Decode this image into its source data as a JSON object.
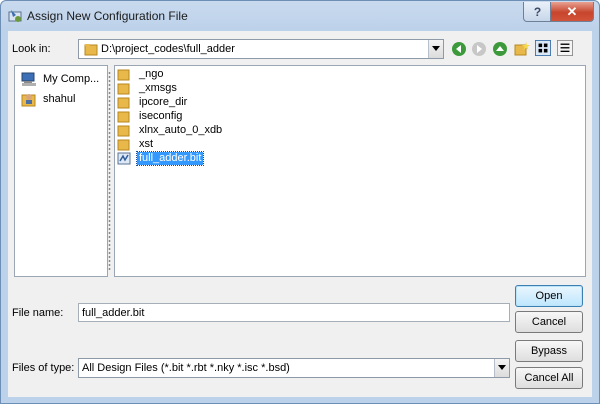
{
  "window": {
    "title": "Assign New Configuration File"
  },
  "look_in": {
    "label": "Look in:",
    "path": "D:\\project_codes\\full_adder"
  },
  "places": [
    {
      "label": "My Comp...",
      "icon": "computer-icon"
    },
    {
      "label": "shahul",
      "icon": "user-folder-icon"
    }
  ],
  "files": [
    {
      "name": "_ngo",
      "icon": "folder-icon",
      "selected": false
    },
    {
      "name": "_xmsgs",
      "icon": "folder-icon",
      "selected": false
    },
    {
      "name": "ipcore_dir",
      "icon": "folder-icon",
      "selected": false
    },
    {
      "name": "iseconfig",
      "icon": "folder-icon",
      "selected": false
    },
    {
      "name": "xlnx_auto_0_xdb",
      "icon": "folder-icon",
      "selected": false
    },
    {
      "name": "xst",
      "icon": "folder-icon",
      "selected": false
    },
    {
      "name": "full_adder.bit",
      "icon": "bitfile-icon",
      "selected": true
    }
  ],
  "file_name": {
    "label": "File name:",
    "value": "full_adder.bit"
  },
  "files_of_type": {
    "label": "Files of type:",
    "value": "All Design Files (*.bit *.rbt *.nky *.isc *.bsd)"
  },
  "buttons": {
    "open": "Open",
    "cancel": "Cancel",
    "bypass": "Bypass",
    "cancel_all": "Cancel All"
  },
  "titlebar": {
    "help": "?",
    "close": "✕"
  },
  "colors": {
    "accent": "#3399ff",
    "folder": "#e8b84a",
    "close": "#c7452c"
  }
}
